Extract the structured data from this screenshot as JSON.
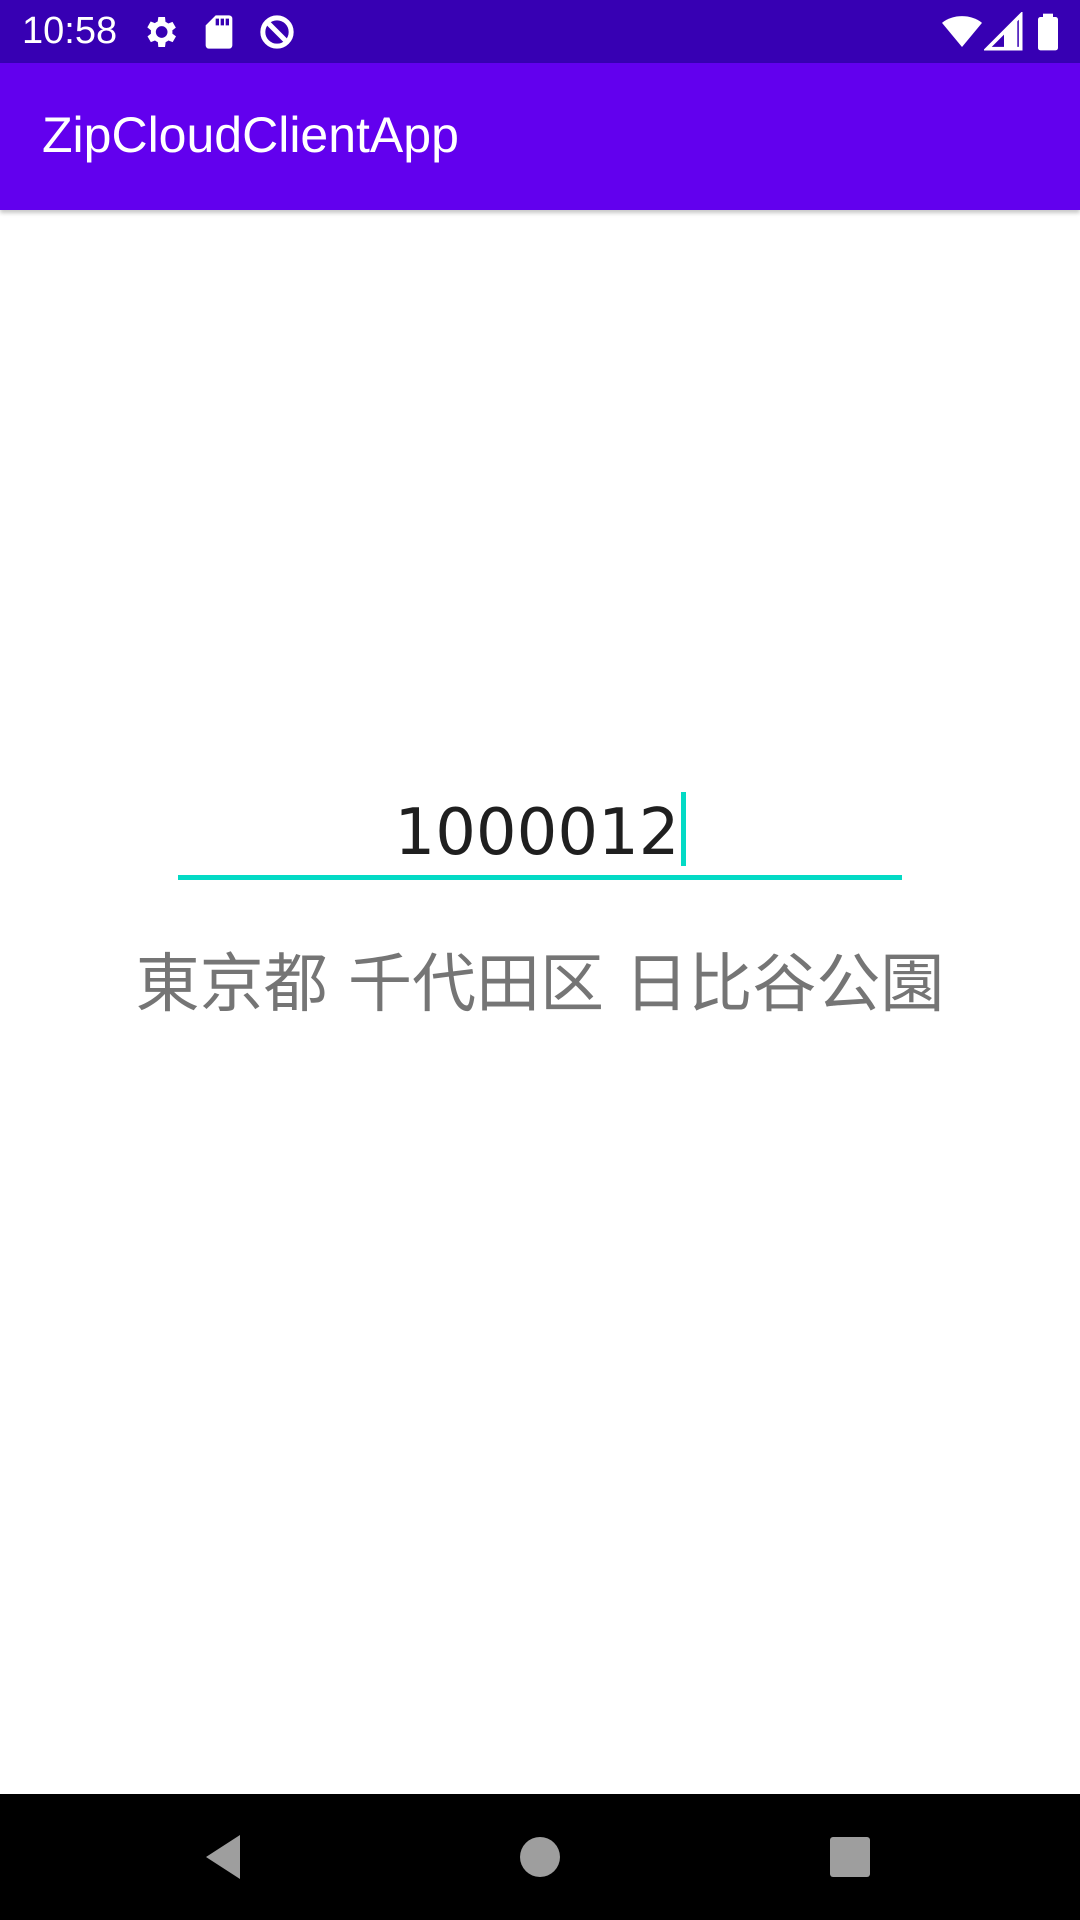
{
  "status_bar": {
    "time": "10:58",
    "left_icons": [
      "settings-gear-icon",
      "sd-card-icon",
      "data-saver-icon"
    ],
    "right_icons": [
      "wifi-icon",
      "cellular-signal-icon",
      "battery-icon"
    ],
    "background": "#3700b3"
  },
  "app_bar": {
    "title": "ZipCloudClientApp",
    "background": "#6200ee"
  },
  "zip_input": {
    "value": "1000012",
    "accent_color": "#03dac5"
  },
  "address": {
    "text": "東京都 千代田区 日比谷公園",
    "color": "#757575"
  },
  "nav_bar": {
    "buttons": [
      "back-icon",
      "home-icon",
      "recents-icon"
    ]
  }
}
